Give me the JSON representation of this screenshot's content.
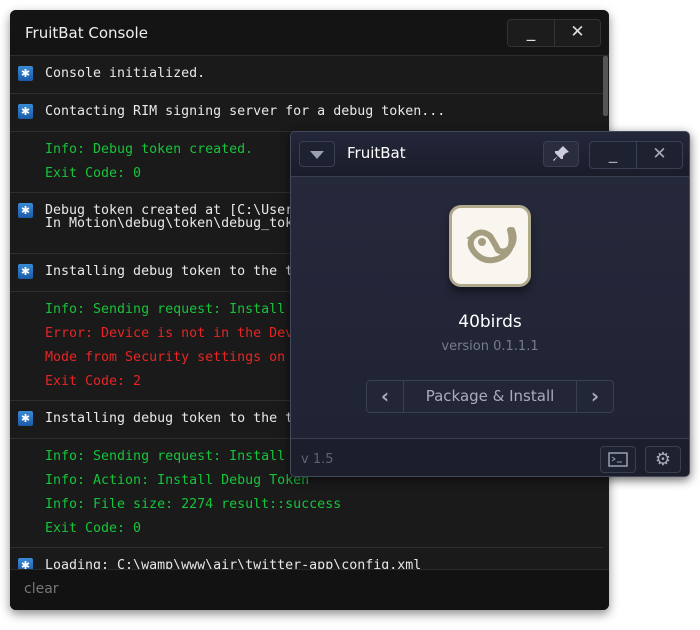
{
  "console": {
    "title": "FruitBat Console",
    "minimize_label": "_",
    "close_label": "✕",
    "entries": [
      {
        "head": "Console initialized.",
        "lines": []
      },
      {
        "head": "Contacting RIM signing server for a debug token...",
        "lines": [
          {
            "text": "Info: Debug token created.",
            "kind": "green"
          },
          {
            "text": "Exit Code: 0",
            "kind": "green"
          }
        ]
      },
      {
        "head": "Debug token created at [C:\\User",
        "lines": [
          {
            "text": "In Motion\\debug\\token\\debug_tok",
            "kind": "white"
          }
        ]
      },
      {
        "head": "Installing debug token to the t",
        "lines": [
          {
            "text": "Info: Sending request: Install",
            "kind": "green"
          },
          {
            "text": "Error: Device is not in the Dev",
            "kind": "red"
          },
          {
            "text": "Mode from Security settings on",
            "kind": "red"
          },
          {
            "text": "Exit Code: 2",
            "kind": "red"
          }
        ]
      },
      {
        "head": "Installing debug token to the t",
        "lines": [
          {
            "text": "Info: Sending request: Install",
            "kind": "green"
          },
          {
            "text": "Info: Action: Install Debug Token",
            "kind": "green"
          },
          {
            "text": "Info: File size: 2274 result::success",
            "kind": "green"
          },
          {
            "text": "Exit Code: 0",
            "kind": "green"
          }
        ]
      },
      {
        "head": "Loading: C:\\wamp\\www\\air\\twitter-app\\config.xml",
        "lines": []
      }
    ],
    "clear_label": "clear"
  },
  "fruitbat": {
    "title": "FruitBat",
    "menu_icon": "triangle-down-icon",
    "pin_icon": "pin-icon",
    "minimize_label": "_",
    "close_label": "✕",
    "app_name": "40birds",
    "app_version": "version 0.1.1.1",
    "action_label": "Package & Install",
    "prev_label": "‹",
    "next_label": "›",
    "version": "v 1.5"
  },
  "colors": {
    "info": "#16c43a",
    "error": "#e82424"
  }
}
